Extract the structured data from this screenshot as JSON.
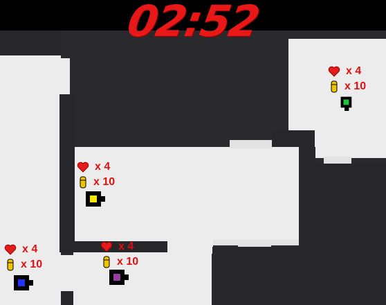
{
  "timer": "02:52",
  "colors": {
    "timer": "#e81818",
    "hud_text": "#e01010",
    "heart": "#e31b1b",
    "ammo": "#f2c200"
  },
  "players": [
    {
      "id": "green",
      "color": "#20c040",
      "lives_label": "x 4",
      "ammo_label": "x 10",
      "icon_heart": "heart-icon",
      "icon_ammo": "bullet-icon"
    },
    {
      "id": "yellow",
      "color": "#f6e800",
      "lives_label": "x 4",
      "ammo_label": "x 10",
      "icon_heart": "heart-icon",
      "icon_ammo": "bullet-icon"
    },
    {
      "id": "blue",
      "color": "#2630ff",
      "lives_label": "x 4",
      "ammo_label": "x 10",
      "icon_heart": "heart-icon",
      "icon_ammo": "bullet-icon"
    },
    {
      "id": "purple",
      "color": "#9b3ca0",
      "lives_label": "x 4",
      "ammo_label": "x 10",
      "icon_heart": "heart-icon",
      "icon_ammo": "bullet-icon"
    }
  ]
}
